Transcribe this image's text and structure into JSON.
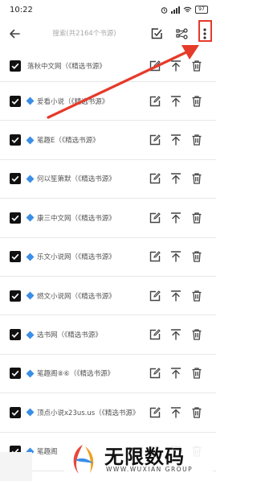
{
  "status": {
    "time": "10:22",
    "battery": "97"
  },
  "toolbar": {
    "search_placeholder": "搜索(共2164个书源)"
  },
  "rows": [
    {
      "label": "落秋中文网（《精选书源》",
      "diamond": false
    },
    {
      "label": "爱看小说（《精选书源》",
      "diamond": true
    },
    {
      "label": "笔趣E（《精选书源》",
      "diamond": true
    },
    {
      "label": "何以笙箫默（《精选书源》",
      "diamond": true
    },
    {
      "label": "康三中文网（《精选书源》",
      "diamond": true
    },
    {
      "label": "乐文小说网（《精选书源》",
      "diamond": true
    },
    {
      "label": "燃文小说网（《精选书源》",
      "diamond": true
    },
    {
      "label": "选书网（《精选书源》",
      "diamond": true
    },
    {
      "label": "笔趣阁⑧⑥（《精选书源》",
      "diamond": true
    },
    {
      "label": "顶点小说x23us.us（《精选书源》",
      "diamond": true
    },
    {
      "label": "笔趣阁",
      "diamond": true
    }
  ],
  "watermark": {
    "cn": "无限数码",
    "en": "WWW.WUXIAN GROUP"
  },
  "colors": {
    "accent": "#3a8ee6",
    "annotation": "#e63a2a"
  }
}
